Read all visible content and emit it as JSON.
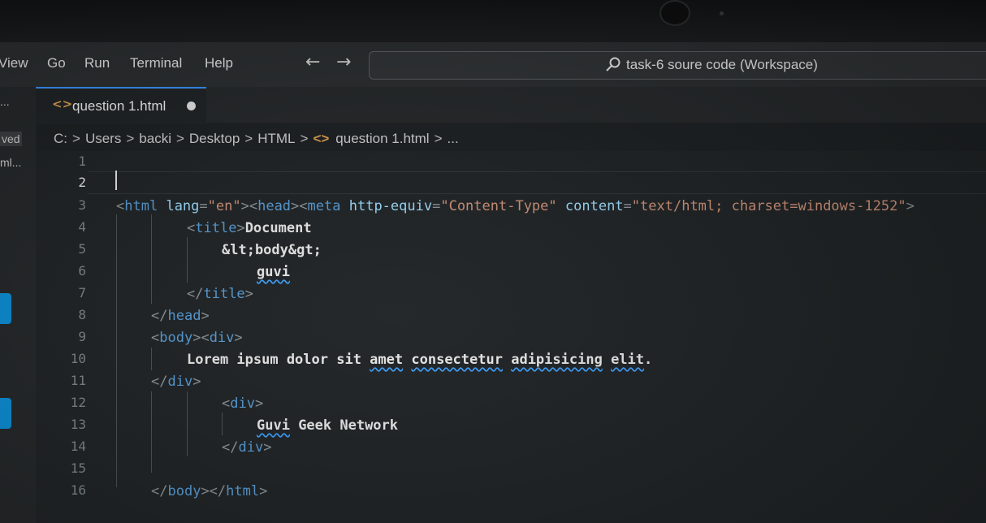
{
  "menu": [
    "View",
    "Go",
    "Run",
    "Terminal",
    "Help"
  ],
  "search": {
    "text": "task-6 soure code (Workspace)"
  },
  "sidebar_fragments": [
    "...",
    "ved",
    "ml..."
  ],
  "tab": {
    "label": "question 1.html"
  },
  "breadcrumb": [
    "C:",
    "Users",
    "backi",
    "Desktop",
    "HTML",
    "question 1.html",
    "..."
  ],
  "line_numbers": [
    "1",
    "2",
    "3",
    "4",
    "5",
    "6",
    "7",
    "8",
    "9",
    "10",
    "11",
    "12",
    "13",
    "14",
    "15",
    "16"
  ],
  "code": {
    "l3": [
      "<",
      "html",
      " ",
      "lang",
      "=",
      "\"en\"",
      "><",
      "head",
      "><",
      "meta",
      " ",
      "http-equiv",
      "=",
      "\"Content-Type\"",
      " ",
      "content",
      "=",
      "\"text/html; charset=windows-1252\"",
      ">"
    ],
    "l4": [
      "<",
      "title",
      ">",
      "Document"
    ],
    "l5": "&lt;body&gt;",
    "l6": "guvi",
    "l7": [
      "</",
      "title",
      ">"
    ],
    "l8": [
      "</",
      "head",
      ">"
    ],
    "l9": [
      "<",
      "body",
      "><",
      "div",
      ">"
    ],
    "l10": [
      "Lorem ipsum dolor sit ",
      "amet",
      " ",
      "consectetur",
      " ",
      "adipisicing",
      " ",
      "elit",
      "."
    ],
    "l11": [
      "</",
      "div",
      ">"
    ],
    "l12": [
      "<",
      "div",
      ">"
    ],
    "l13": [
      "Guvi",
      " Geek Network"
    ],
    "l14": [
      "</",
      "div",
      ">"
    ],
    "l16": [
      "</",
      "body",
      "></",
      "html",
      ">"
    ]
  },
  "colors": {
    "accent": "#3794ff",
    "tag": "#569cd6",
    "attribute": "#9cdcfe",
    "string": "#ce9178",
    "squiggle": "#3aa0ff"
  },
  "icons": [
    "search-icon",
    "back-arrow-icon",
    "forward-arrow-icon",
    "html-file-icon",
    "unsaved-dot-icon"
  ]
}
